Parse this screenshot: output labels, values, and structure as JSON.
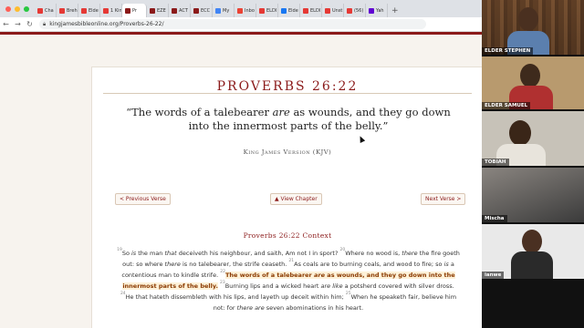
{
  "browser": {
    "tabs": [
      {
        "label": "Cha",
        "color": "#e53935"
      },
      {
        "label": "Breh",
        "color": "#e53935"
      },
      {
        "label": "Elde",
        "color": "#e53935"
      },
      {
        "label": "1 Kin",
        "color": "#e53935"
      },
      {
        "label": "Pr",
        "color": "#8b1a1a",
        "active": true
      },
      {
        "label": "EZE",
        "color": "#8b1a1a"
      },
      {
        "label": "ACT",
        "color": "#8b1a1a"
      },
      {
        "label": "ECC",
        "color": "#8b1a1a"
      },
      {
        "label": "My",
        "color": "#4285f4"
      },
      {
        "label": "Inbo",
        "color": "#ea4335"
      },
      {
        "label": "ELDI",
        "color": "#e53935"
      },
      {
        "label": "Elde",
        "color": "#1877f2"
      },
      {
        "label": "ELDI",
        "color": "#e53935"
      },
      {
        "label": "Unst",
        "color": "#e53935"
      },
      {
        "label": "(56)",
        "color": "#e53935"
      },
      {
        "label": "Yah",
        "color": "#6001d2"
      }
    ],
    "new_tab": "+",
    "url": "kingjamesbibleonline.org/Proverbs-26-22/"
  },
  "page": {
    "title": "Proverbs 26:22",
    "quote_part1": "“The words of a talebearer ",
    "quote_em": "are",
    "quote_part2": " as wounds, and they go down into the innermost parts of the belly.”",
    "version": "King James Version (KJV)",
    "prev_button": "< Previous Verse",
    "chapter_button": "▲ View Chapter",
    "next_button": "Next Verse >",
    "context_title": "Proverbs 26:22 Context"
  },
  "context": {
    "v19": "19",
    "t19a": "So ",
    "t19em": "is",
    "t19b": " the man ",
    "t19em2": "that",
    "t19c": " deceiveth his neighbour, and saith, Am not I in sport? ",
    "v20": "20",
    "t20a": "Where no wood is, ",
    "t20em": "there",
    "t20b": " the fire goeth out: so where ",
    "t20em2": "there",
    "t20c": " is no talebearer, the strife ceaseth. ",
    "v21": "21",
    "t21a": "As coals are to burning coals, and wood to fire; so ",
    "t21em": "is",
    "t21b": " a contentious man to kindle strife. ",
    "v22": "22",
    "t22a": "The words of a talebearer ",
    "t22em": "are",
    "t22b": " as wounds, and they go down into the innermost parts of the belly.",
    "v23": "23",
    "t23a": "Burning lips and a wicked heart ",
    "t23em": "are like",
    "t23b": " a potsherd covered with silver dross. ",
    "v24": "24",
    "t24": "He that hateth dissembleth with his lips, and layeth up deceit within him; ",
    "v25": "25",
    "t25a": "When he speaketh fair, believe him not: for ",
    "t25em": "there are",
    "t25b": " seven abominations in his heart."
  },
  "video": {
    "tiles": [
      {
        "name": "ELDER STEPHEN"
      },
      {
        "name": "ELDER SAMUEL"
      },
      {
        "name": "TOBIAH"
      },
      {
        "name": "Mischa"
      },
      {
        "name": "ianwe"
      }
    ]
  },
  "colors": {
    "accent": "#8b1a1a",
    "highlight": "#fdf1d8"
  }
}
